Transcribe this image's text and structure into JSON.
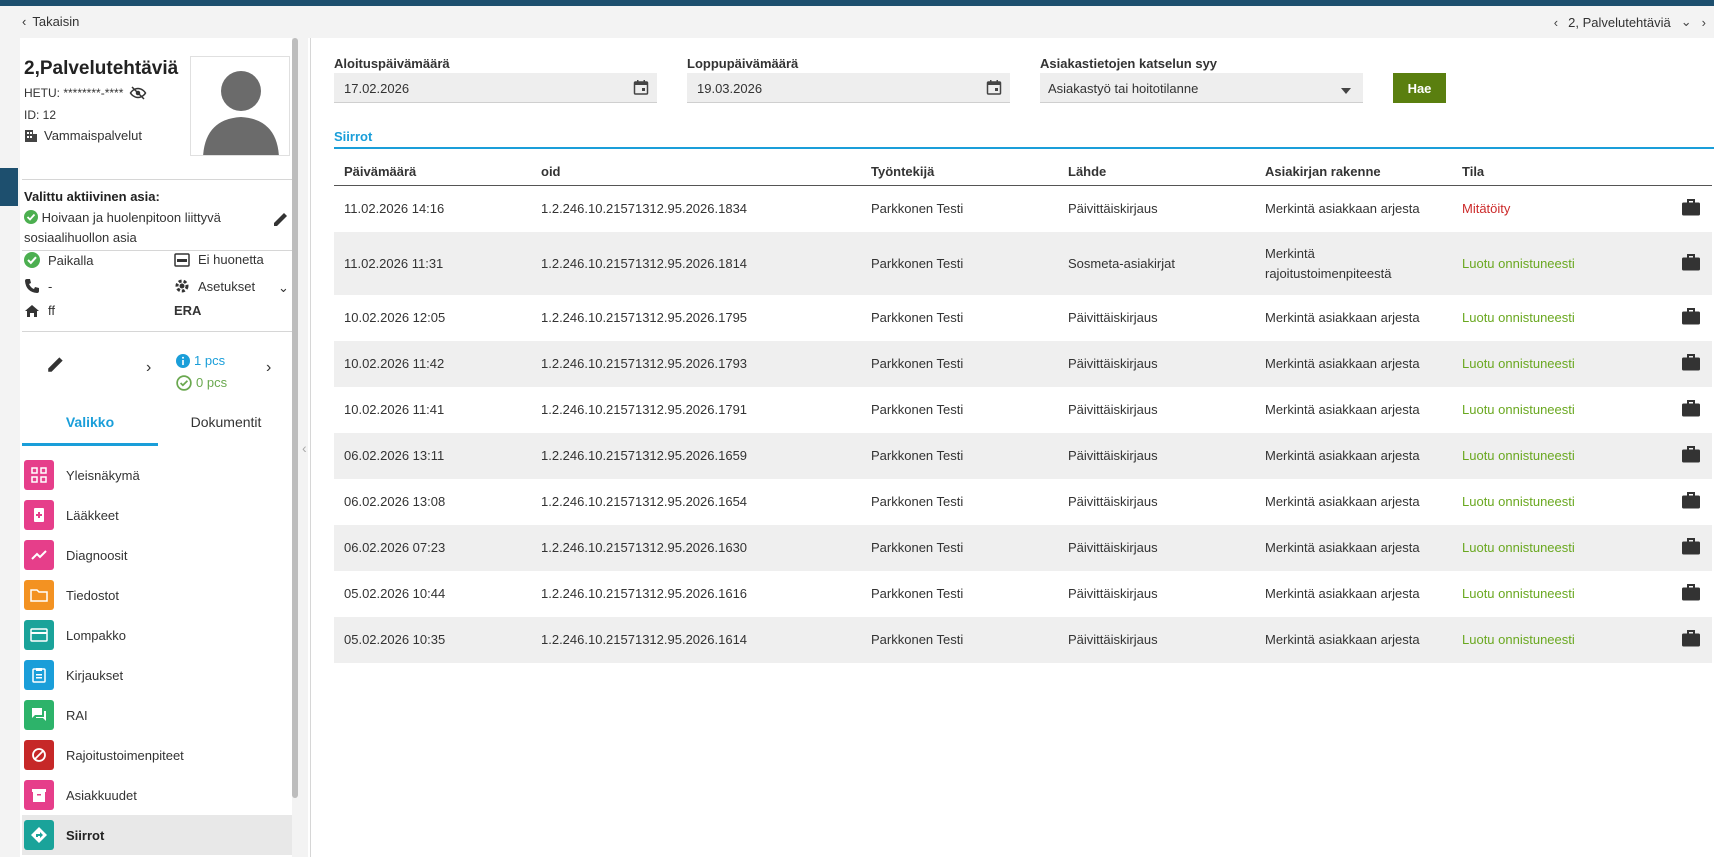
{
  "topbar": {
    "back_label": "Takaisin",
    "context_label": "2, Palvelutehtäviä"
  },
  "patient": {
    "name": "2,Palvelutehtäviä",
    "hetu": "HETU: ********-****",
    "id": "ID: 12",
    "unit": "Vammaispalvelut"
  },
  "active_case": {
    "title": "Valittu aktiivinen asia:",
    "text": "Hoivaan ja huolenpitoon liittyvä sosiaalihuollon asia"
  },
  "info": {
    "presence": "Paikalla",
    "room": "Ei huonetta",
    "phone": "-",
    "settings": "Asetukset",
    "home": "ff",
    "era": "ERA"
  },
  "counts": {
    "info": "1 pcs",
    "done": "0 pcs"
  },
  "tabs": [
    "Valikko",
    "Dokumentit"
  ],
  "menu": [
    {
      "label": "Yleisnäkymä",
      "color": "#e63e8a"
    },
    {
      "label": "Lääkkeet",
      "color": "#e63e8a"
    },
    {
      "label": "Diagnoosit",
      "color": "#e63e8a"
    },
    {
      "label": "Tiedostot",
      "color": "#f39222"
    },
    {
      "label": "Lompakko",
      "color": "#1aa39a"
    },
    {
      "label": "Kirjaukset",
      "color": "#1a9ed9"
    },
    {
      "label": "RAI",
      "color": "#2db36a"
    },
    {
      "label": "Rajoitustoimenpiteet",
      "color": "#c62828"
    },
    {
      "label": "Asiakkuudet",
      "color": "#e63e8a"
    },
    {
      "label": "Siirrot",
      "color": "#1aa39a"
    }
  ],
  "filters": {
    "start_label": "Aloituspäivämäärä",
    "start_value": "17.02.2026",
    "end_label": "Loppupäivämäärä",
    "end_value": "19.03.2026",
    "reason_label": "Asiakastietojen katselun syy",
    "reason_value": "Asiakastyö tai hoitotilanne",
    "search_label": "Hae"
  },
  "section_title": "Siirrot",
  "table": {
    "headers": [
      "Päivämäärä",
      "oid",
      "Työntekijä",
      "Lähde",
      "Asiakirjan rakenne",
      "Tila"
    ],
    "rows": [
      [
        "11.02.2026 14:16",
        "1.2.246.10.21571312.95.2026.1834",
        "Parkkonen Testi",
        "Päivittäiskirjaus",
        "Merkintä asiakkaan arjesta",
        "Mitätöity"
      ],
      [
        "11.02.2026 11:31",
        "1.2.246.10.21571312.95.2026.1814",
        "Parkkonen Testi",
        "Sosmeta-asiakirjat",
        "Merkintä rajoitustoimenpiteestä",
        "Luotu onnistuneesti"
      ],
      [
        "10.02.2026 12:05",
        "1.2.246.10.21571312.95.2026.1795",
        "Parkkonen Testi",
        "Päivittäiskirjaus",
        "Merkintä asiakkaan arjesta",
        "Luotu onnistuneesti"
      ],
      [
        "10.02.2026 11:42",
        "1.2.246.10.21571312.95.2026.1793",
        "Parkkonen Testi",
        "Päivittäiskirjaus",
        "Merkintä asiakkaan arjesta",
        "Luotu onnistuneesti"
      ],
      [
        "10.02.2026 11:41",
        "1.2.246.10.21571312.95.2026.1791",
        "Parkkonen Testi",
        "Päivittäiskirjaus",
        "Merkintä asiakkaan arjesta",
        "Luotu onnistuneesti"
      ],
      [
        "06.02.2026 13:11",
        "1.2.246.10.21571312.95.2026.1659",
        "Parkkonen Testi",
        "Päivittäiskirjaus",
        "Merkintä asiakkaan arjesta",
        "Luotu onnistuneesti"
      ],
      [
        "06.02.2026 13:08",
        "1.2.246.10.21571312.95.2026.1654",
        "Parkkonen Testi",
        "Päivittäiskirjaus",
        "Merkintä asiakkaan arjesta",
        "Luotu onnistuneesti"
      ],
      [
        "06.02.2026 07:23",
        "1.2.246.10.21571312.95.2026.1630",
        "Parkkonen Testi",
        "Päivittäiskirjaus",
        "Merkintä asiakkaan arjesta",
        "Luotu onnistuneesti"
      ],
      [
        "05.02.2026 10:44",
        "1.2.246.10.21571312.95.2026.1616",
        "Parkkonen Testi",
        "Päivittäiskirjaus",
        "Merkintä asiakkaan arjesta",
        "Luotu onnistuneesti"
      ],
      [
        "05.02.2026 10:35",
        "1.2.246.10.21571312.95.2026.1614",
        "Parkkonen Testi",
        "Päivittäiskirjaus",
        "Merkintä asiakkaan arjesta",
        "Luotu onnistuneesti"
      ]
    ]
  },
  "colors": {
    "accent": "#1a9ed9",
    "search_button": "#5a7f0f",
    "status_ok": "#6aa820",
    "status_cancelled": "#cc2a2a"
  }
}
